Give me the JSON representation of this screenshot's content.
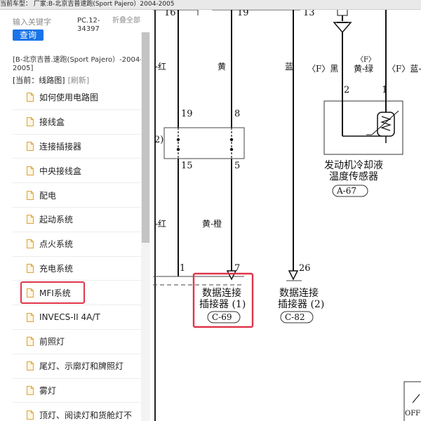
{
  "topbar": {
    "text": "当前车型： 厂家:B-北京吉普速跑(Sport Pajero）2004-2005"
  },
  "sidebar": {
    "search": {
      "placeholder": "输入关键字",
      "button": "查询"
    },
    "pc_code": "PC.12-34397",
    "collapse_all": "折叠全部",
    "breadcrumb": "[B-北京吉普.速跑(Sport Pajero）-2004-2005]",
    "current": "[当前：线路图]",
    "refresh": "[刷新]",
    "items": [
      {
        "label": "如何使用电路图"
      },
      {
        "label": "接线盒"
      },
      {
        "label": "连接插接器"
      },
      {
        "label": "中央接线盒"
      },
      {
        "label": "配电"
      },
      {
        "label": "起动系统"
      },
      {
        "label": "点火系统"
      },
      {
        "label": "充电系统"
      },
      {
        "label": "MFI系统",
        "selected": true
      },
      {
        "label": "INVECS-II 4A/T"
      },
      {
        "label": "前照灯"
      },
      {
        "label": "尾灯、示廓灯和牌照灯"
      },
      {
        "label": "雾灯"
      },
      {
        "label": "顶灯、阅读灯和货舱灯不"
      }
    ]
  },
  "diagram": {
    "pins": {
      "top_left": "16",
      "top_mid": "19",
      "top_right": "13",
      "box_top_left": "19",
      "box_top_right": "8",
      "box_bot_left": "15",
      "box_bot_right": "5",
      "con1_left": "1",
      "con1_right": "7",
      "con2": "26",
      "sensor_left": "2",
      "sensor_right": "1",
      "box_left_mark": "2)"
    },
    "wires": {
      "w1_top": "-红",
      "w2_top": "黄",
      "w3_top": "蓝",
      "w4": "〈F〉黑",
      "w4_tag": "〈F〉",
      "w5": "黄-绿",
      "w6": "〈F〉蓝-",
      "w1_bot": "-红",
      "w2_bot": "黄-橙"
    },
    "sensor": {
      "name_line1": "发动机冷却液",
      "name_line2": "温度传感器",
      "ref": "A-67"
    },
    "connector1": {
      "name_line1": "数据连接",
      "name_line2": "插接器 (1)",
      "ref": "C-69"
    },
    "connector2": {
      "name_line1": "数据连接",
      "name_line2": "插接器 (2)",
      "ref": "C-82"
    },
    "corner": "OFF",
    "highlight_color": "#e0354a"
  }
}
